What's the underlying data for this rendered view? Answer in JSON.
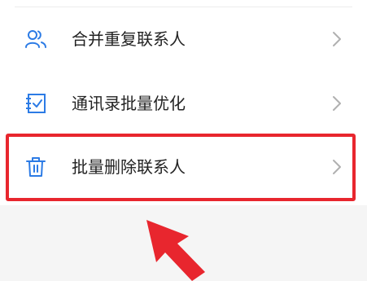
{
  "menu": {
    "items": [
      {
        "label": "合并重复联系人",
        "icon": "contacts-merge-icon"
      },
      {
        "label": "通讯录批量优化",
        "icon": "checklist-icon"
      },
      {
        "label": "批量删除联系人",
        "icon": "trash-icon"
      }
    ]
  },
  "colors": {
    "icon_blue": "#2c7be5",
    "highlight_red": "#e8262e",
    "chevron_gray": "#b0b0b0"
  }
}
